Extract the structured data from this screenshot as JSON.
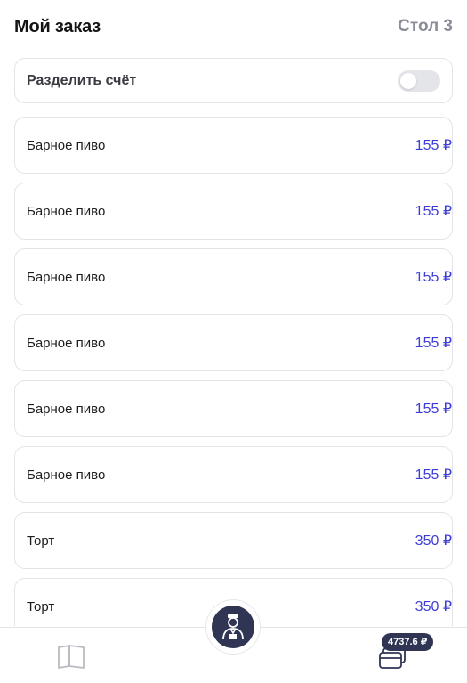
{
  "header": {
    "title": "Мой заказ",
    "table": "Стол 3"
  },
  "split_bill": {
    "label": "Разделить счёт",
    "enabled": false
  },
  "items": [
    {
      "name": "Барное пиво",
      "price": "155 ₽"
    },
    {
      "name": "Барное пиво",
      "price": "155 ₽"
    },
    {
      "name": "Барное пиво",
      "price": "155 ₽"
    },
    {
      "name": "Барное пиво",
      "price": "155 ₽"
    },
    {
      "name": "Барное пиво",
      "price": "155 ₽"
    },
    {
      "name": "Барное пиво",
      "price": "155 ₽"
    },
    {
      "name": "Торт",
      "price": "350 ₽"
    },
    {
      "name": "Торт",
      "price": "350 ₽"
    }
  ],
  "bottom_bar": {
    "menu_icon": "book-icon",
    "waiter_icon": "waiter-icon",
    "pay_icon": "credit-card-icon",
    "total": "4737.6 ₽"
  },
  "colors": {
    "accent_price": "#3d3dd8",
    "dark_button": "#2f3553",
    "muted_text": "#8a8d99",
    "border": "#e3e4e8"
  }
}
